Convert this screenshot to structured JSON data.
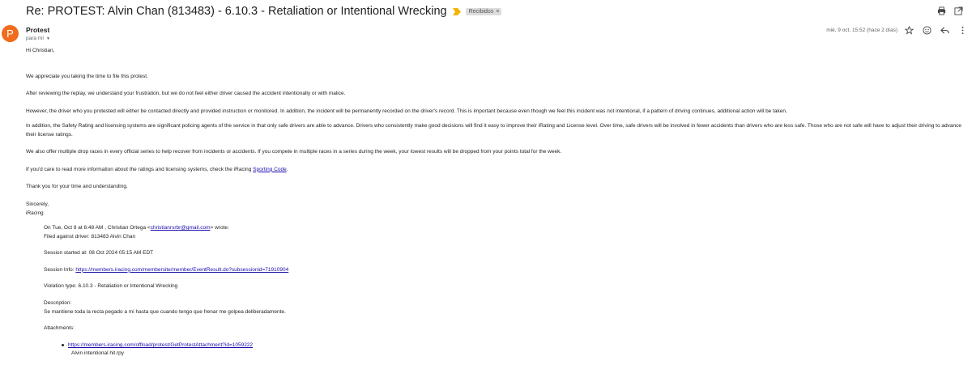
{
  "header": {
    "subject": "Re: PROTEST: Alvin Chan (813483) - 6.10.3 - Retaliation or Intentional Wrecking",
    "label": "Recibidos",
    "label_remove": "×"
  },
  "message": {
    "avatar_letter": "P",
    "sender": "Protest",
    "to": "para mí",
    "date": "mié, 9 oct, 15:52 (hace 2 días)",
    "greeting": "Hi Christian,",
    "paragraphs": [
      "We appreciate you taking the time to file this protest.",
      "After reviewing the replay, we understand your frustration, but we do not feel either driver caused the accident intentionally or with malice.",
      "However, the driver who you protested will either be contacted directly and provided instruction or monitored. In addition, the incident will be permanently recorded on the driver's record. This is important because even though we feel this incident was not intentional, if a pattern of driving continues, additional action will be taken.",
      "In addition, the Safety Rating and licensing systems are significant policing agents of the service in that only safe drivers are able to advance. Drivers who consistently make good decisions will find it easy to improve their iRating and License level. Over time, safe drivers will be involved in fewer accidents than drivers who are less safe. Those who are not safe will have to adjust their driving to advance their license ratings.",
      "We also offer multiple drop races in every official series to help recover from incidents or accidents. If you compete in multiple races in a series during the week, your lowest results will be dropped from your points total for the week."
    ],
    "ratings_text": "If you'd care to read more information about the ratings and licensing systems, check the iRacing ",
    "ratings_link": "Sporting Code",
    "ratings_end": ".",
    "thanks": "Thank you for your time and understanding.",
    "sign_1": "Sincerely,",
    "sign_2": "iRacing"
  },
  "quote": {
    "intro_before": "On Tue, Oct 8 at 6:48 AM , Christian Ortega <",
    "intro_email": "christianrsrbr@gmail.com",
    "intro_after": "> wrote:",
    "filed": "Filed against driver: 813483 Alvin Chan",
    "session_started": "Session started at: 08 Oct 2024 05:15 AM EDT",
    "session_info_label": "Session Info: ",
    "session_info_link": "https://members.iracing.com/membersite/member/EventResult.do?subsessionid=71910904",
    "violation": "Violation type: 6.10.3 - Retaliation or Intentional Wrecking",
    "description_label": "Description:",
    "description": "Se mantiene toda la recta pegado a mi hasta que cuando tengo que frenar me golpea deliberadamente.",
    "attachments_label": "Attachments:",
    "attachment_link": "https://members.iracing.com/offload/protest/GetProtestAttachment?id=1059222",
    "attachment_name": "Alvin intentional hit.rpy"
  },
  "icons": {
    "print": "print-icon",
    "open_new": "open-in-new-window-icon",
    "star": "star-icon",
    "emoji": "emoji-icon",
    "reply": "reply-icon",
    "more": "more-vertical-icon",
    "importance": "importance-marker-icon"
  },
  "colors": {
    "avatar": "#ef6c1c",
    "importance": "#f4b400",
    "link": "#1a0dab"
  }
}
